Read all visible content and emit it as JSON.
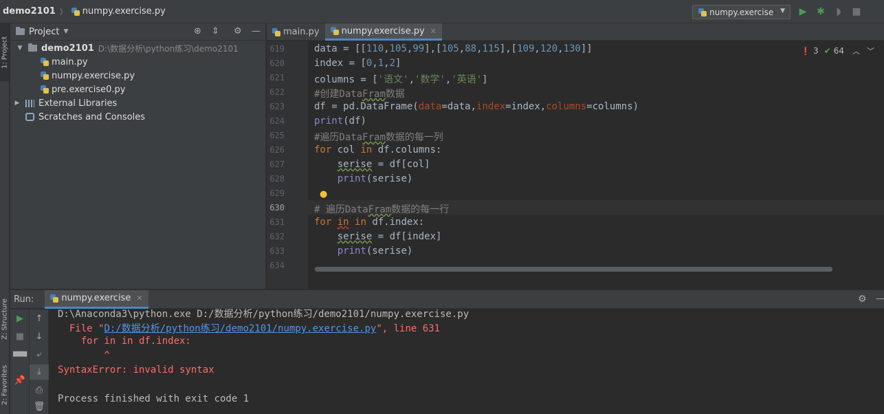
{
  "navbar": {
    "project": "demo2101",
    "file": "numpy.exercise.py",
    "run_config": "numpy.exercise"
  },
  "side_tabs": {
    "project": "1: Project",
    "structure": "Z: Structure",
    "favorites": "2: Favorites"
  },
  "project_panel": {
    "title": "Project",
    "root": {
      "name": "demo2101",
      "path": "D:\\数据分析\\python练习\\demo2101"
    },
    "files": [
      "main.py",
      "numpy.exercise.py",
      "pre.exercise0.py"
    ],
    "external_libraries": "External Libraries",
    "scratches": "Scratches and Consoles"
  },
  "editor": {
    "tabs": [
      {
        "label": "main.py",
        "active": false
      },
      {
        "label": "numpy.exercise.py",
        "active": true
      }
    ],
    "inspections": {
      "errors": "3",
      "warnings": "64"
    },
    "line_numbers": [
      "619",
      "620",
      "621",
      "622",
      "623",
      "624",
      "625",
      "626",
      "627",
      "628",
      "629",
      "630",
      "631",
      "632",
      "633",
      "634"
    ]
  },
  "run_panel": {
    "label": "Run:",
    "tab": "numpy.exercise",
    "console": {
      "cmd": "D:\\Anaconda3\\python.exe D:/数据分析/python练习/demo2101/numpy.exercise.py",
      "file_prefix": "  File \"",
      "file_link": "D:/数据分析/python练习/demo2101/numpy.exercise.py",
      "file_suffix": "\", line 631",
      "code": "    for in in df.index:",
      "caret": "        ^",
      "error": "SyntaxError: invalid syntax",
      "finished": "Process finished with exit code 1"
    }
  },
  "colors": {
    "background": "#2b2b2b",
    "panel": "#3c3f41",
    "keyword": "#cc7832",
    "number": "#6897bb",
    "string": "#6a8759",
    "error": "#ff6b68",
    "link": "#5394ec"
  }
}
